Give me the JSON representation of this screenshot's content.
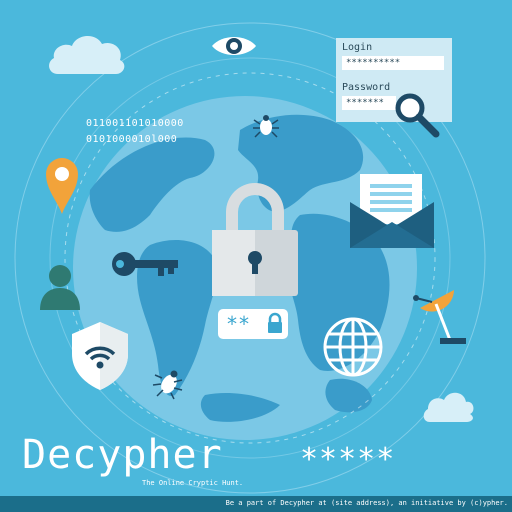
{
  "login": {
    "login_label": "Login",
    "login_value": "**********",
    "password_label": "Password",
    "password_value": "*******"
  },
  "binary": {
    "line1": "011001101010000",
    "line2": "0101000010l000"
  },
  "lock_badge": "**",
  "brand": {
    "title": "Decypher",
    "stars": "*****",
    "tagline": "The Online Cryptic Hunt."
  },
  "footer": {
    "text": "Be a part of Decypher at (site address), an initiative by (c)ypher."
  },
  "colors": {
    "background": "#4bb8dc",
    "globe_ocean": "#7bc8e6",
    "globe_land": "#3a9cca",
    "accent_orange": "#f2a33a",
    "dark_navy": "#1e4a66",
    "lock_gray": "#cfd6da"
  },
  "icons": [
    "eye-icon",
    "cloud-icon",
    "magnifier-icon",
    "location-pin-icon",
    "bug-icon",
    "envelope-icon",
    "key-icon",
    "padlock-icon",
    "user-icon",
    "wifi-shield-icon",
    "globe-web-icon",
    "satellite-dish-icon"
  ]
}
